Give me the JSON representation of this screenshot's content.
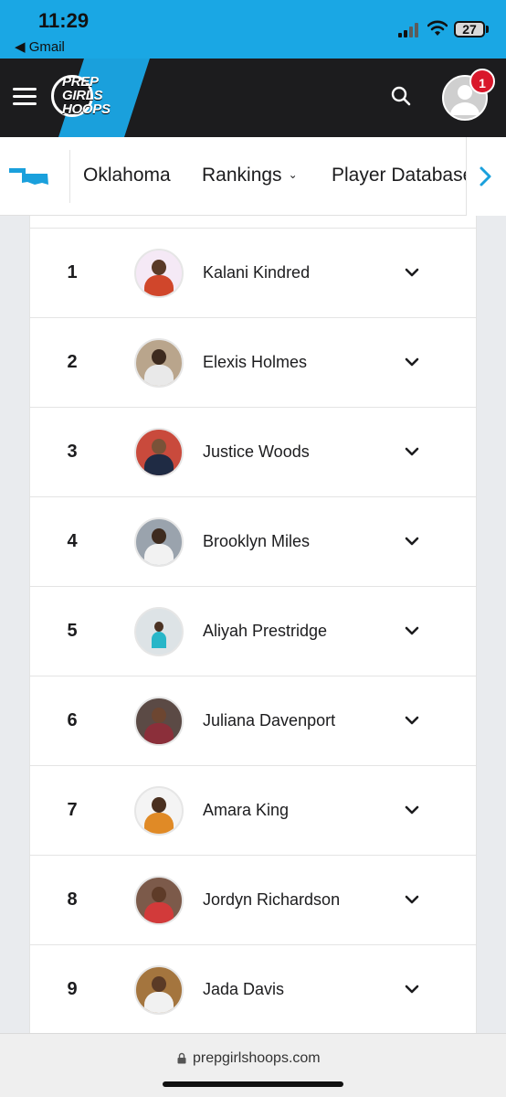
{
  "status_bar": {
    "time": "11:29",
    "back_label": "◀ Gmail",
    "battery": "27"
  },
  "header": {
    "logo_lines": [
      "PREP",
      "GIRLS",
      "HOOPS"
    ],
    "notification_count": "1",
    "colors": {
      "bar": "#1c1c1e",
      "accent": "#1aa0dc",
      "badge": "#d9182b"
    }
  },
  "subnav": {
    "state_icon": "oklahoma-state-icon",
    "items": [
      {
        "label": "Oklahoma"
      },
      {
        "label": "Rankings"
      },
      {
        "label": "Player Database"
      }
    ]
  },
  "rankings": [
    {
      "rank": "1",
      "name": "Kalani Kindred",
      "icon": "player-photo"
    },
    {
      "rank": "2",
      "name": "Elexis Holmes",
      "icon": "player-photo"
    },
    {
      "rank": "3",
      "name": "Justice Woods",
      "icon": "player-photo"
    },
    {
      "rank": "4",
      "name": "Brooklyn Miles",
      "icon": "player-photo"
    },
    {
      "rank": "5",
      "name": "Aliyah Prestridge",
      "icon": "player-photo"
    },
    {
      "rank": "6",
      "name": "Juliana Davenport",
      "icon": "player-photo"
    },
    {
      "rank": "7",
      "name": "Amara King",
      "icon": "player-photo"
    },
    {
      "rank": "8",
      "name": "Jordyn Richardson",
      "icon": "player-photo"
    },
    {
      "rank": "9",
      "name": "Jada Davis",
      "icon": "player-photo"
    }
  ],
  "browser": {
    "url": "prepgirlshoops.com"
  }
}
